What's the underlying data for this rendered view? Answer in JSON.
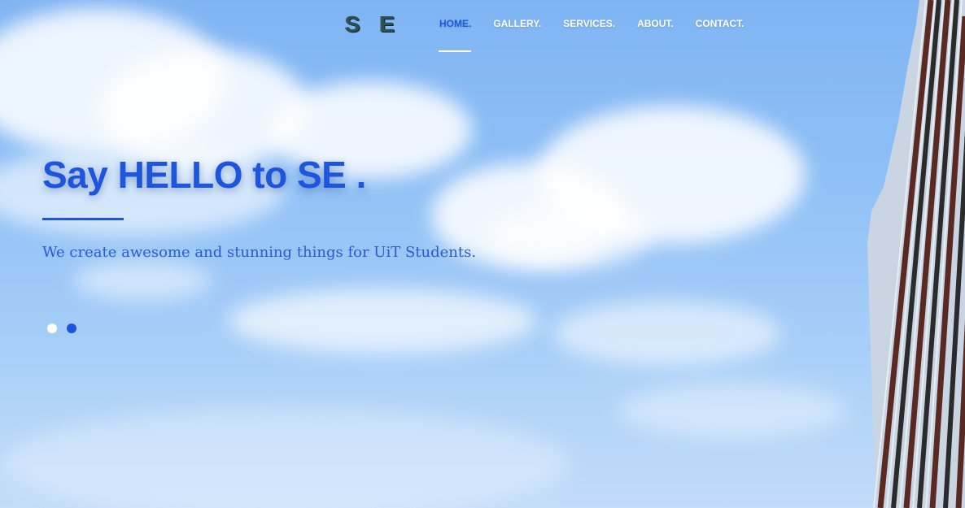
{
  "brand": {
    "logo_text": "S E"
  },
  "nav": {
    "items": [
      {
        "label": "HOME.",
        "active": true
      },
      {
        "label": "GALLERY.",
        "active": false
      },
      {
        "label": "SERVICES.",
        "active": false
      },
      {
        "label": "ABOUT.",
        "active": false
      },
      {
        "label": "CONTACT.",
        "active": false
      }
    ]
  },
  "hero": {
    "title": "Say HELLO to SE .",
    "subtitle": "We create awesome and stunning things for UiT Students."
  },
  "slider": {
    "dots": 2,
    "active_index": 1
  },
  "colors": {
    "accent": "#1e55dd",
    "sky": "#8fc0f6",
    "logo": "#2f4f57"
  }
}
